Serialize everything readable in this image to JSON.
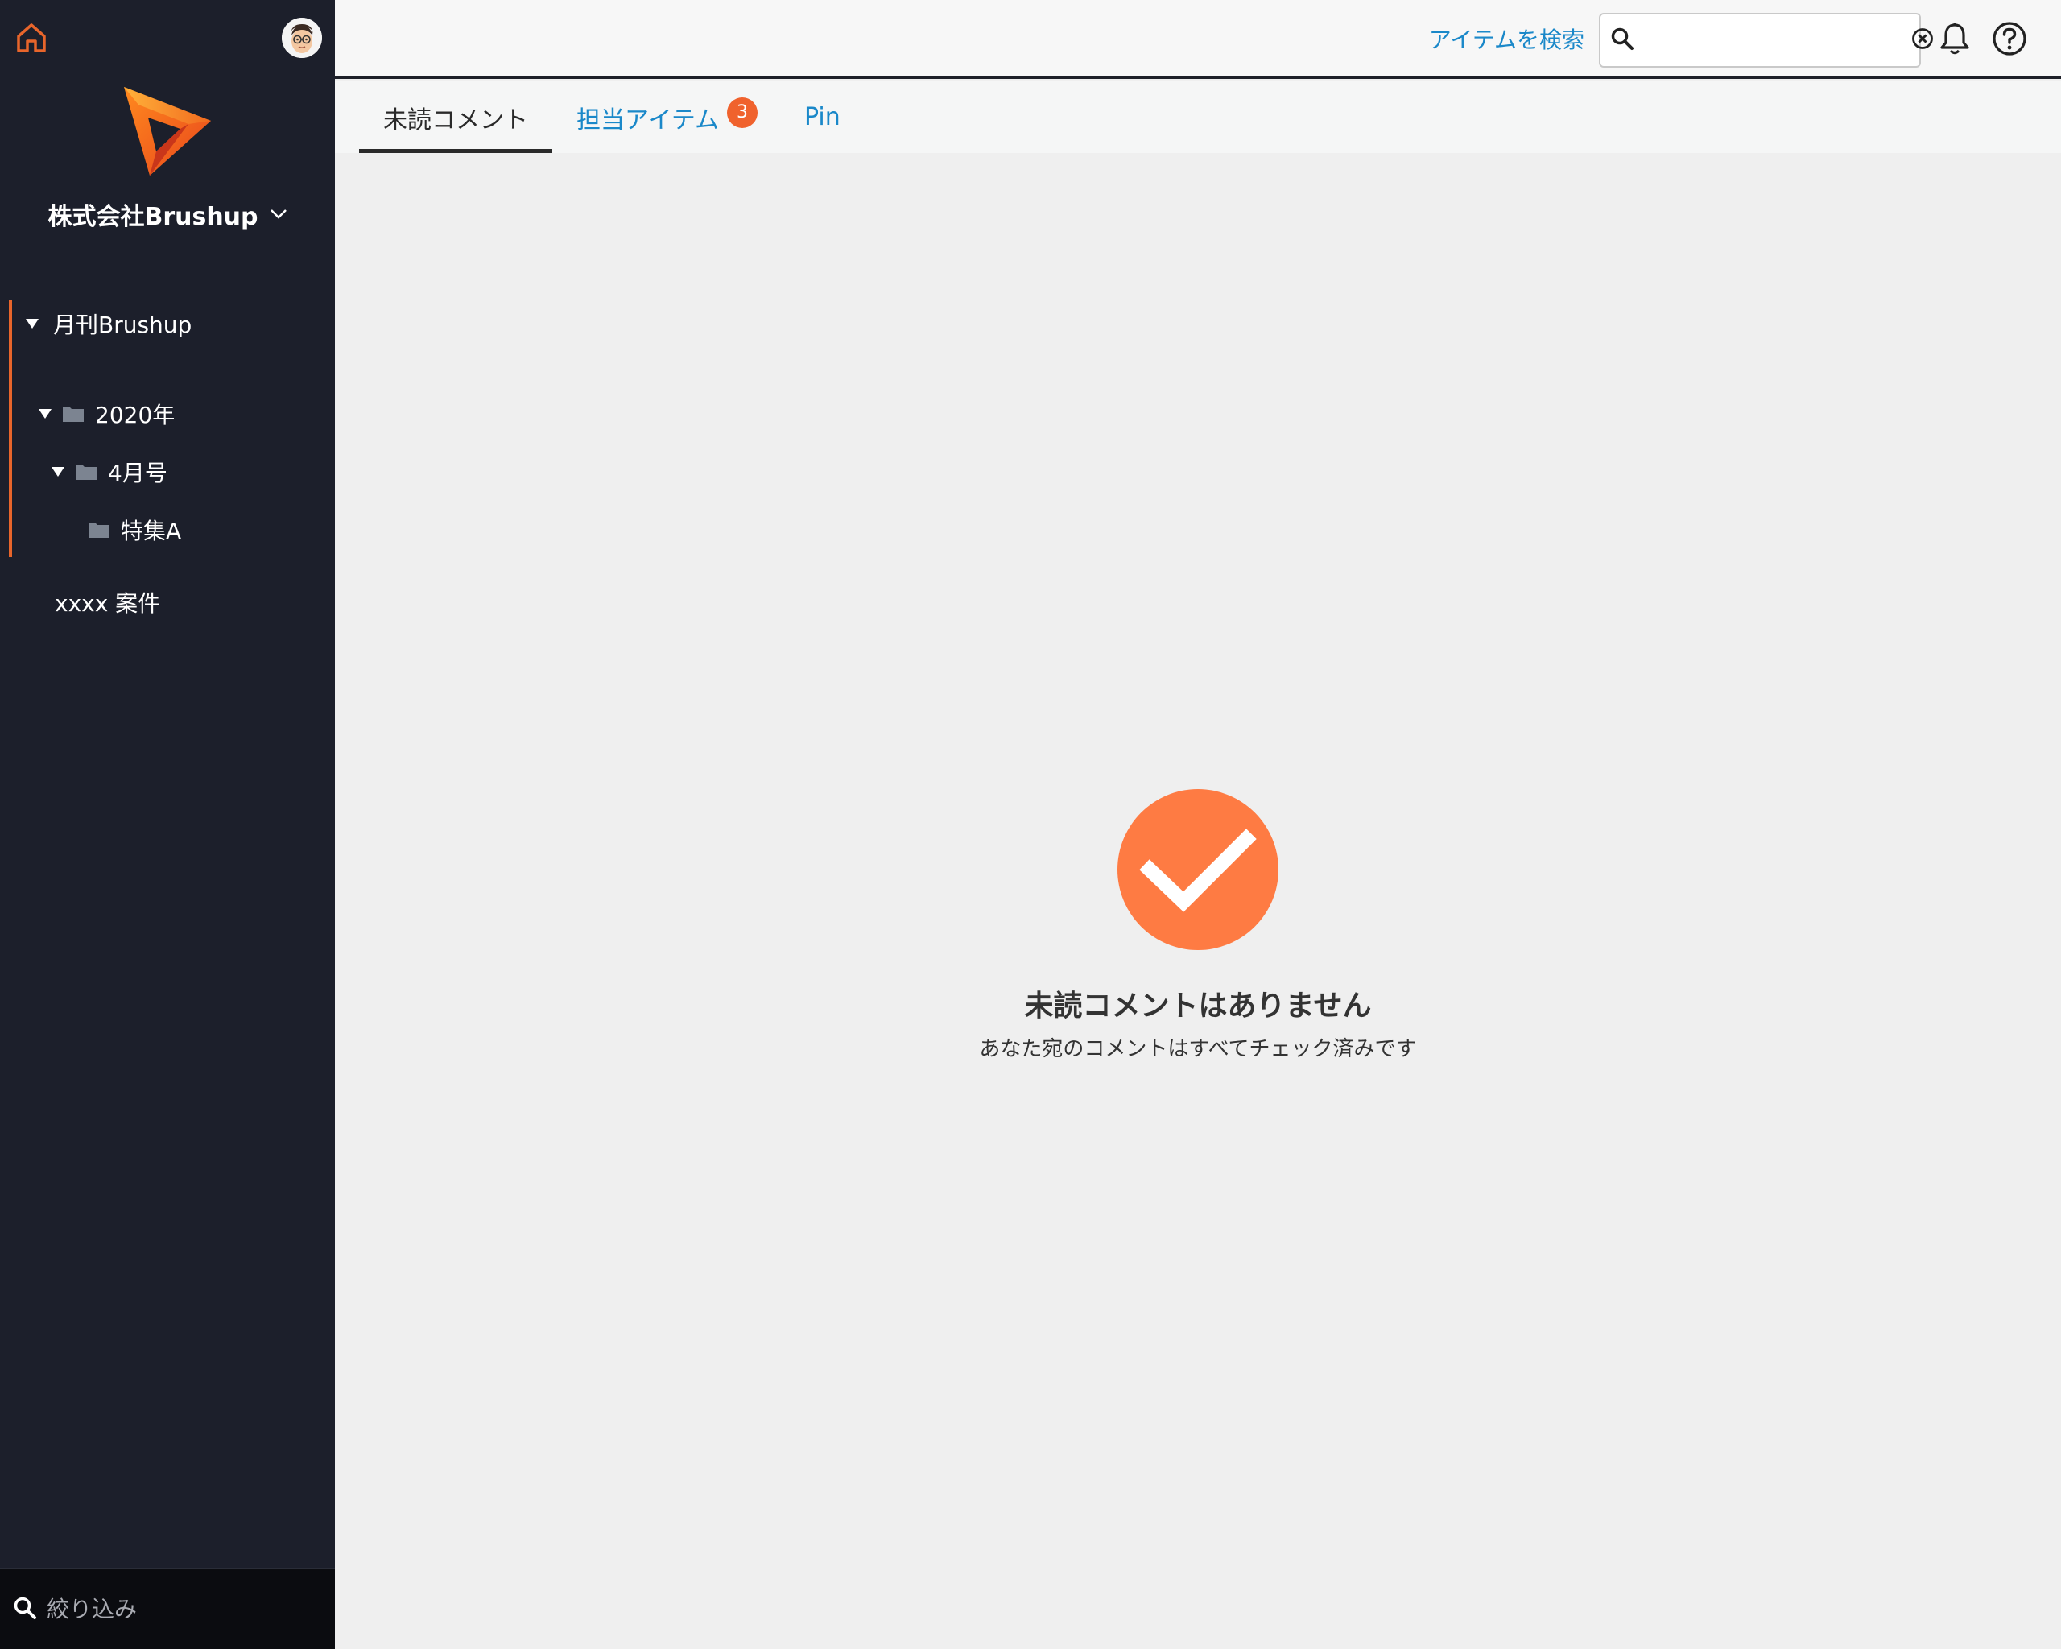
{
  "sidebar": {
    "org_name": "株式会社Brushup",
    "tree": [
      {
        "label": "月刊Brushup",
        "level": 0,
        "expanded": true,
        "folder": false
      },
      {
        "label": "2020年",
        "level": 1,
        "expanded": true,
        "folder": true
      },
      {
        "label": "4月号",
        "level": 2,
        "expanded": true,
        "folder": true
      },
      {
        "label": "特集A",
        "level": 3,
        "expanded": false,
        "folder": true
      }
    ],
    "project_item": "xxxx 案件",
    "filter_placeholder": "絞り込み"
  },
  "header": {
    "search_label": "アイテムを検索",
    "search_value": ""
  },
  "tabs": [
    {
      "label": "未読コメント",
      "active": true
    },
    {
      "label": "担当アイテム",
      "active": false,
      "badge": "3"
    },
    {
      "label": "Pin",
      "active": false
    }
  ],
  "empty_state": {
    "title": "未読コメントはありません",
    "description": "あなた宛のコメントはすべてチェック済みです"
  },
  "colors": {
    "accent_orange": "#fe7b43",
    "link_blue": "#1a88c9",
    "sidebar_bg": "#1c1f2b",
    "badge": "#f0622d"
  },
  "icons": [
    "home-icon",
    "avatar",
    "brushup-logo",
    "chevron-down-icon",
    "caret-down-icon",
    "folder-icon",
    "search-icon",
    "clear-icon",
    "bell-icon",
    "help-icon",
    "checkmark-icon"
  ]
}
